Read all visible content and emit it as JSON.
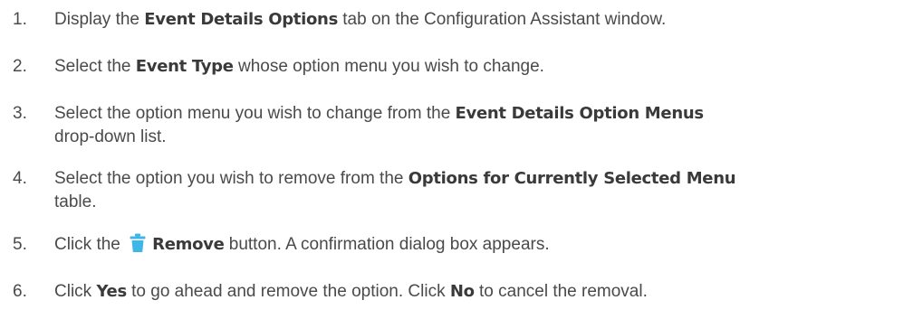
{
  "steps": [
    {
      "num": "1.",
      "pre": "Display the ",
      "bold": "Event Details Options",
      "post": " tab on the Configuration Assistant window."
    },
    {
      "num": "2.",
      "pre": "Select the ",
      "bold": "Event Type",
      "post": " whose option menu you wish to change."
    },
    {
      "num": "3.",
      "pre": "Select the option menu you wish to change from the ",
      "bold": "Event Details Option Menus",
      "post": "",
      "line2": "drop-down list."
    },
    {
      "num": "4.",
      "pre": "Select the option you wish to remove from the ",
      "bold": "Options for Currently Selected Menu",
      "post": "",
      "line2": "table."
    },
    {
      "num": "5.",
      "pre": "Click the ",
      "icon": "trash-icon",
      "bold": "Remove",
      "post": " button. A confirmation dialog box appears."
    },
    {
      "num": "6.",
      "pre": "Click ",
      "bold": "Yes",
      "mid": " to go ahead and remove the option. Click ",
      "bold2": "No",
      "post": " to cancel the removal."
    }
  ],
  "colors": {
    "text": "#4a4a4a",
    "icon": "#3fb6e6"
  }
}
